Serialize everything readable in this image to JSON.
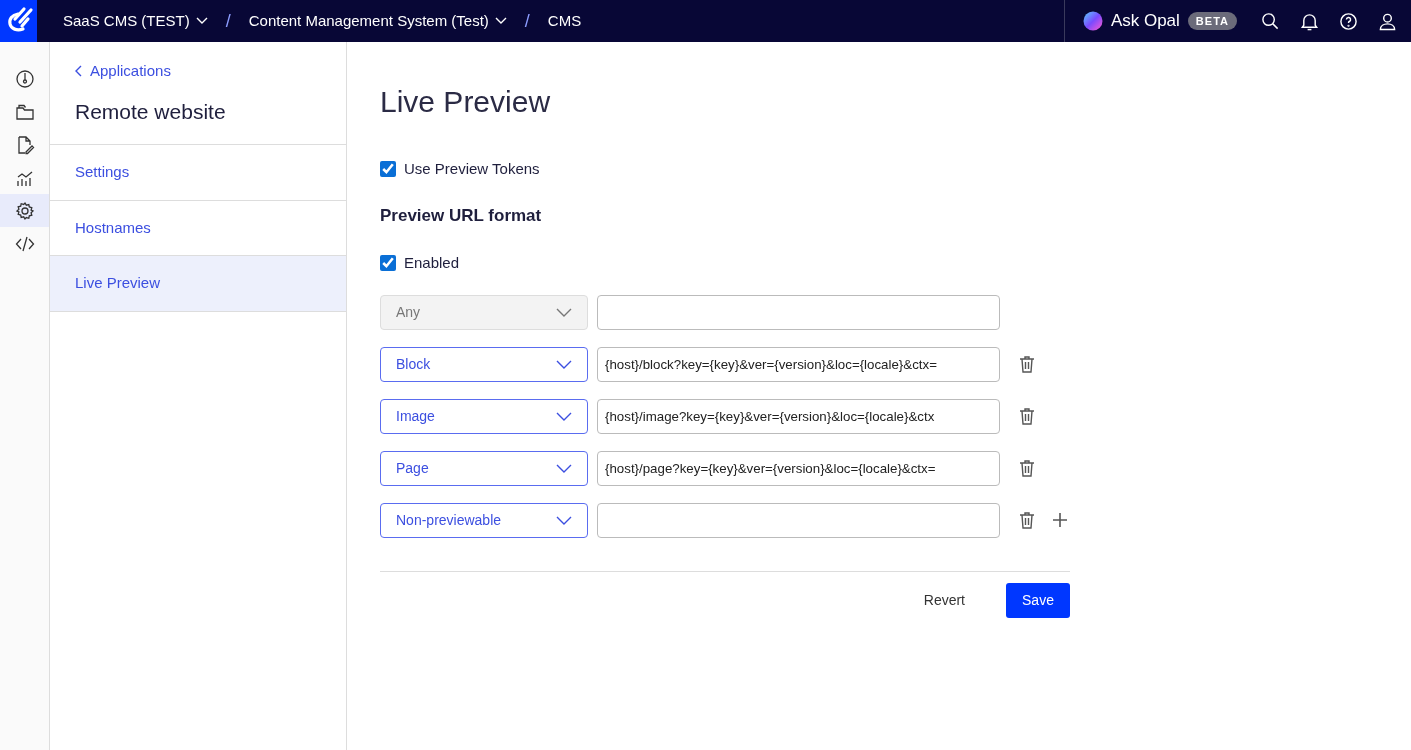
{
  "topbar": {
    "breadcrumbs": [
      {
        "label": "SaaS CMS (TEST)",
        "dropdown": true
      },
      {
        "separator": "/",
        "label": "Content Management System (Test)",
        "dropdown": true
      },
      {
        "separator": "/",
        "label": "CMS",
        "dropdown": false
      }
    ],
    "assistant": {
      "label": "Ask Opal",
      "badge": "BETA"
    }
  },
  "rail": [
    {
      "selected": false
    },
    {
      "selected": false
    },
    {
      "selected": false
    },
    {
      "selected": false
    },
    {
      "selected": true
    },
    {
      "selected": false
    }
  ],
  "sidebar": {
    "back": "Applications",
    "title": "Remote website",
    "items": [
      {
        "label": "Settings",
        "selected": false
      },
      {
        "label": "Hostnames",
        "selected": false
      },
      {
        "label": "Live Preview",
        "selected": true
      }
    ]
  },
  "main": {
    "title": "Live Preview",
    "use_tokens": {
      "label": "Use Preview Tokens",
      "checked": true
    },
    "section": "Preview URL format",
    "enabled": {
      "label": "Enabled",
      "checked": true
    },
    "rows": [
      {
        "type": "Any",
        "disabled": true,
        "value": "",
        "deletable": false
      },
      {
        "type": "Block",
        "disabled": false,
        "value": "{host}/block?key={key}&ver={version}&loc={locale}&ctx=",
        "deletable": true
      },
      {
        "type": "Image",
        "disabled": false,
        "value": "{host}/image?key={key}&ver={version}&loc={locale}&ctx",
        "deletable": true
      },
      {
        "type": "Page",
        "disabled": false,
        "value": "{host}/page?key={key}&ver={version}&loc={locale}&ctx=",
        "deletable": true
      },
      {
        "type": "Non-previewable",
        "disabled": false,
        "value": "",
        "deletable": true
      }
    ],
    "add": true,
    "revert": "Revert",
    "save": "Save"
  }
}
